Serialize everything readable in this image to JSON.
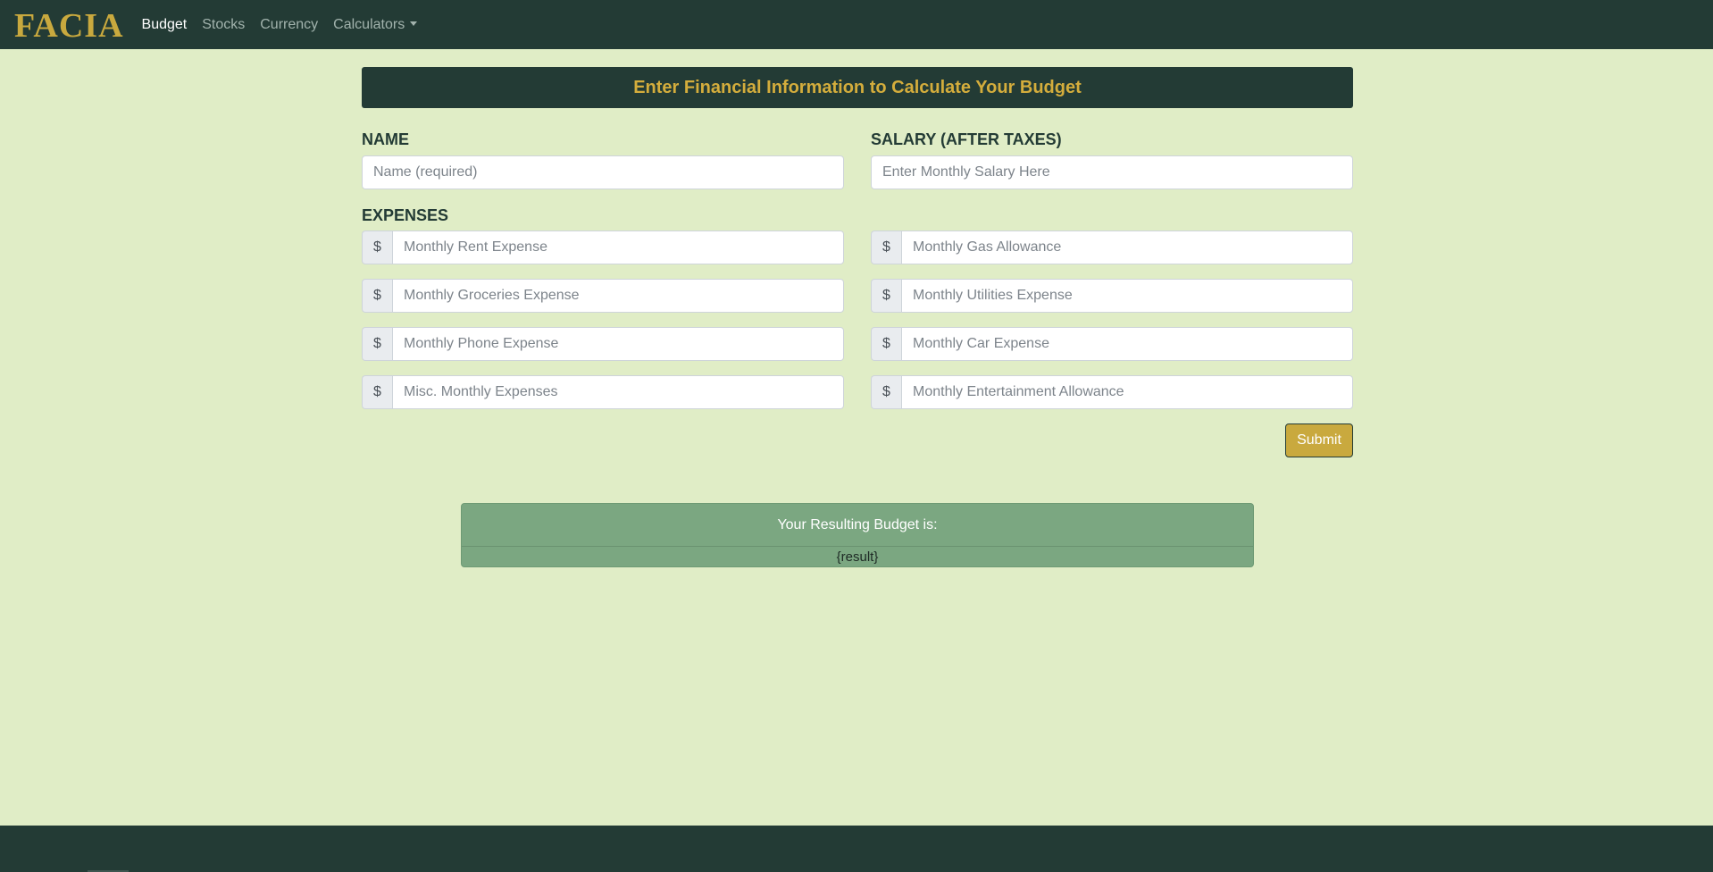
{
  "navbar": {
    "brand": "FACIA",
    "links": [
      {
        "label": "Budget",
        "active": true
      },
      {
        "label": "Stocks",
        "active": false
      },
      {
        "label": "Currency",
        "active": false
      },
      {
        "label": "Calculators",
        "active": false,
        "dropdown": true
      }
    ]
  },
  "form": {
    "header": "Enter Financial Information to Calculate Your Budget",
    "name_label": "NAME",
    "name_placeholder": "Name (required)",
    "salary_label": "SALARY (AFTER TAXES)",
    "salary_placeholder": "Enter Monthly Salary Here",
    "expenses_label": "EXPENSES",
    "currency_symbol": "$",
    "expenses": [
      {
        "placeholder": "Monthly Rent Expense"
      },
      {
        "placeholder": "Monthly Gas Allowance"
      },
      {
        "placeholder": "Monthly Groceries Expense"
      },
      {
        "placeholder": "Monthly Utilities Expense"
      },
      {
        "placeholder": "Monthly Phone Expense"
      },
      {
        "placeholder": "Monthly Car Expense"
      },
      {
        "placeholder": "Misc. Monthly Expenses"
      },
      {
        "placeholder": "Monthly Entertainment Allowance"
      }
    ],
    "submit_label": "Submit"
  },
  "result": {
    "title": "Your Resulting Budget is:",
    "value": "{result}"
  },
  "colors": {
    "navbar_bg": "#233b35",
    "page_bg": "#e0edc6",
    "accent_gold": "#c9a93e",
    "result_bg": "#7ba781"
  }
}
